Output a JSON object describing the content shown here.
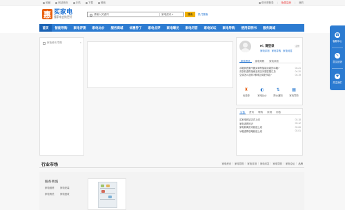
{
  "topbar": {
    "left": [
      "收藏",
      "网站首页",
      "手机",
      "下载",
      "微信"
    ],
    "right": [
      "你好请登录",
      "免费注册",
      "我的"
    ]
  },
  "header": {
    "logo_mark": "惠",
    "logo_name": "买家电",
    "slogan": "懂家电会挑更好",
    "search_placeholder": "请输入关键词",
    "search_scope": "家电资讯",
    "search_button": "搜索",
    "extra_link": "热门搜索"
  },
  "nav": [
    "首页",
    "智能导购",
    "家电评测",
    "家电比价",
    "服务商城",
    "优惠券了",
    "家电点评",
    "家电曝光",
    "家电问答",
    "家电论坛",
    "家电导购",
    "使用说明书",
    "服务商城"
  ],
  "leftpanel": {
    "crumb": "家电资讯 导购",
    "close": "×"
  },
  "userbox": {
    "greet": "Hi, 请登录",
    "greet_right": "注册",
    "links": [
      "家电评测",
      "家电导购",
      "家电问答"
    ],
    "tabs": [
      "家电资讯",
      "家电导购",
      "家电评测"
    ],
    "news": [
      {
        "t": "冰箱到底要不要买带有智能功能的冰箱?",
        "d": "04-21"
      },
      {
        "t": "洗衣机选购指南及常见问题答疑汇总",
        "d": "04-20"
      },
      {
        "t": "空调怎么选购?哪种空调更节能?",
        "d": "04-19"
      }
    ],
    "icons": [
      {
        "g": "♜",
        "label": "优惠券",
        "orange": true
      },
      {
        "g": "◐",
        "label": "家电比价",
        "orange": false
      },
      {
        "g": "⇅",
        "label": "降价通知",
        "orange": false
      },
      {
        "g": "▦",
        "label": "家电导购",
        "orange": false
      }
    ]
  },
  "newsbox": {
    "tabs": [
      "公告",
      "资讯",
      "导购",
      "评测",
      "问答"
    ],
    "items": [
      {
        "t": "买家电网站正式上线",
        "d": "03-18"
      },
      {
        "t": "家电选购知识",
        "d": "03-12"
      },
      {
        "t": "家电新闻资讯频道上线",
        "d": "03-06"
      },
      {
        "t": "冰箱选购攻略频道上线",
        "d": "03-01"
      }
    ]
  },
  "section": {
    "title": "行业市场",
    "links": [
      "家电资讯",
      "家电导购",
      "家电评测",
      "家电问答",
      "家电导购",
      "家电论坛",
      "品牌"
    ]
  },
  "bottom": {
    "svc_title": "服务商城",
    "svc_items": [
      "家电维修",
      "家电安装",
      "家电清洗",
      "家电回收"
    ]
  },
  "sidebar": [
    {
      "g": "☎",
      "label": "客服中心"
    },
    {
      "g": "✎",
      "label": "意见反馈"
    },
    {
      "g": "♥",
      "label": "关注我们"
    }
  ]
}
